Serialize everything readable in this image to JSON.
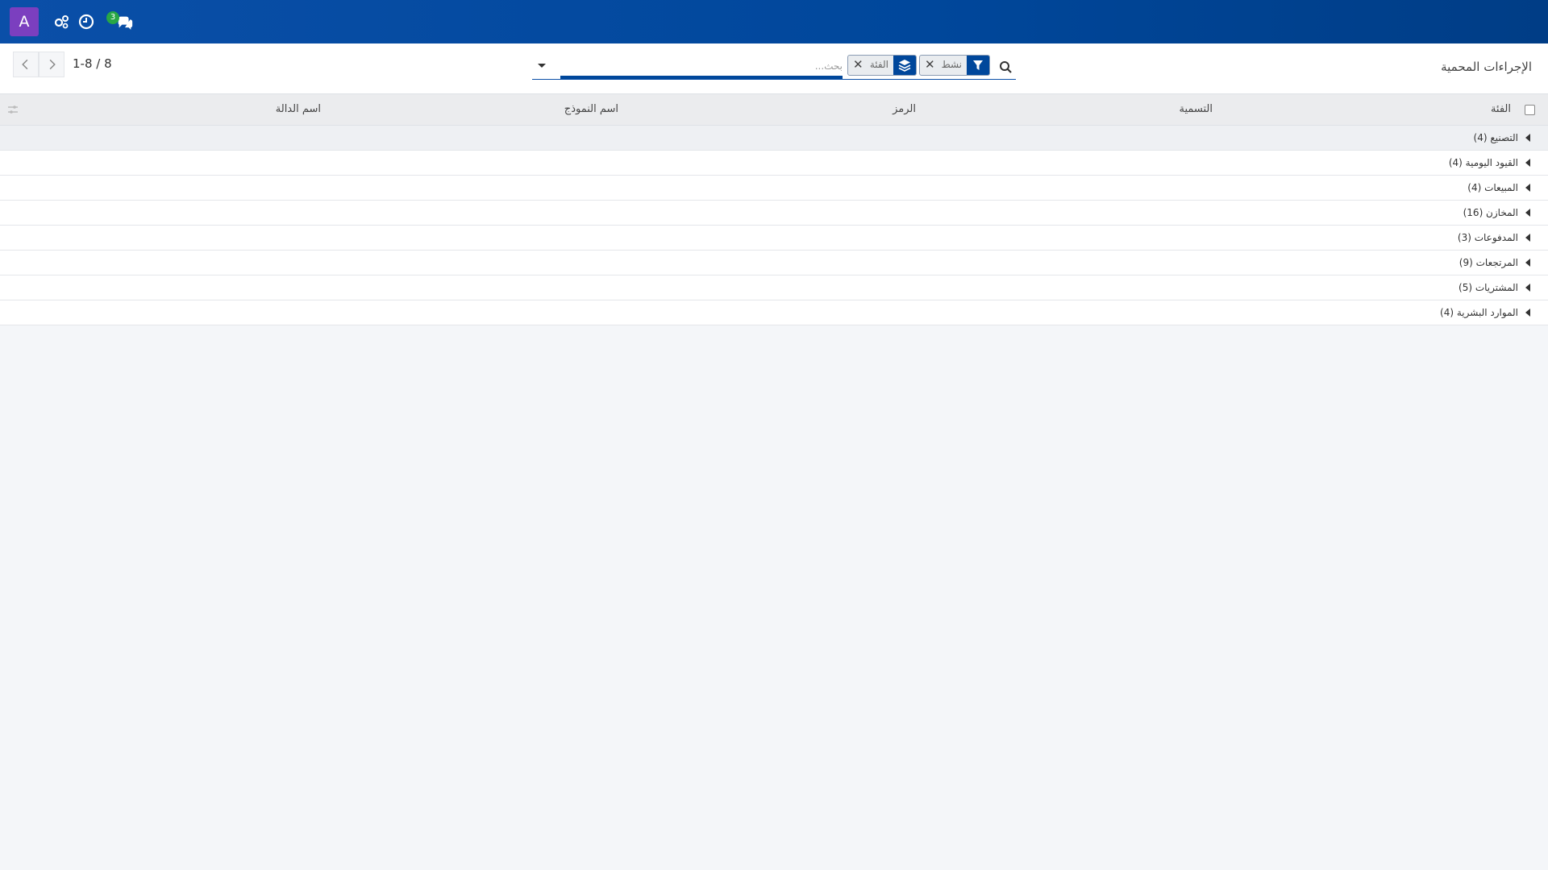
{
  "navbar": {
    "avatar_letter": "A",
    "icons": [
      "activity-settings-icon",
      "clock-icon",
      "chat-icon"
    ],
    "messages_count": "3",
    "background": "#00479b",
    "avatar_color": "#7b3fbf",
    "badge_color": "#28a745"
  },
  "control_panel": {
    "title": "الإجراءات المحمية",
    "search": {
      "placeholder": "بحث...",
      "facets": [
        {
          "icon": "filter-icon",
          "value": "نشط"
        },
        {
          "icon": "group-by-icon",
          "value": "الفئة"
        }
      ]
    },
    "pager": {
      "value": "1-8 / 8"
    }
  },
  "list": {
    "columns": [
      "الفئة",
      "التسمية",
      "الرمز",
      "اسم النموذج",
      "اسم الدالة"
    ],
    "groups": [
      "التصنيع (4)",
      "القيود اليومية (4)",
      "المبيعات (4)",
      "المخازن (16)",
      "المدفوعات (3)",
      "المرتجعات (9)",
      "المشتريات (5)",
      "الموارد البشرية (4)"
    ]
  }
}
